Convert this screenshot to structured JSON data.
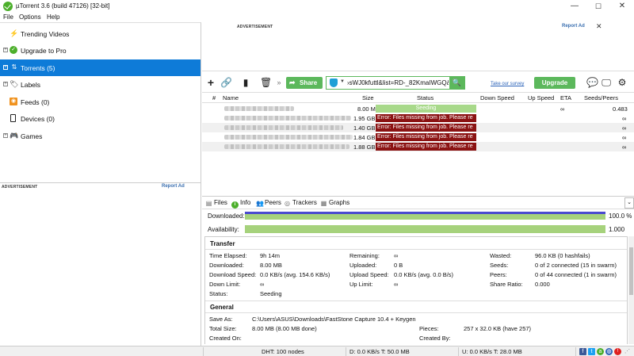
{
  "window": {
    "title": "µTorrent 3.6  (build 47126) [32-bit]",
    "minimize": "—",
    "maximize": "☐",
    "close": "✕"
  },
  "menu": [
    "File",
    "Options",
    "Help"
  ],
  "sidebar": {
    "items": [
      {
        "label": "Trending Videos",
        "icon": "bolt-icon"
      },
      {
        "label": "Upgrade to Pro",
        "icon": "utorrent-logo-icon"
      },
      {
        "label": "Torrents (5)",
        "icon": "torrents-icon",
        "selected": true
      },
      {
        "label": "Labels",
        "icon": "tag-icon"
      },
      {
        "label": "Feeds (0)",
        "icon": "rss-icon"
      },
      {
        "label": "Devices (0)",
        "icon": "device-icon"
      },
      {
        "label": "Games",
        "icon": "gamepad-icon"
      }
    ]
  },
  "ads": {
    "sidebar_label": "ADVERTISEMENT",
    "sidebar_report": "Report Ad",
    "top_label": "ADVERTISEMENT",
    "top_report": "Report Ad",
    "close": "✕"
  },
  "toolbar": {
    "share_label": "Share",
    "url_value": "›sWJ0kfuttl&list=RD-_82KmaIWGQ&index=19",
    "survey_link": "Take our survey",
    "upgrade_label": "Upgrade"
  },
  "table": {
    "columns": [
      "#",
      "Name",
      "Size",
      "Status",
      "Down Speed",
      "Up Speed",
      "ETA",
      "Seeds/Peers"
    ],
    "rows": [
      {
        "size": "8.00 MB",
        "status": "Seeding",
        "status_kind": "seeding",
        "eta": "∞",
        "seeds_peers": "0.483"
      },
      {
        "size": "1.95 GB",
        "status": "Error: Files missing from job. Please re",
        "status_kind": "error",
        "eta": "",
        "seeds_peers": "∞"
      },
      {
        "size": "1.40 GB",
        "status": "Error: Files missing from job. Please re",
        "status_kind": "error",
        "eta": "",
        "seeds_peers": "∞"
      },
      {
        "size": "1.84 GB",
        "status": "Error: Files missing from job. Please re",
        "status_kind": "error",
        "eta": "",
        "seeds_peers": "∞"
      },
      {
        "size": "1.88 GB",
        "status": "Error: Files missing from job. Please re",
        "status_kind": "error",
        "eta": "",
        "seeds_peers": "∞"
      }
    ]
  },
  "detail_tabs": [
    "Files",
    "Info",
    "Peers",
    "Trackers",
    "Graphs"
  ],
  "progress": {
    "downloaded_label": "Downloaded:",
    "downloaded_value": "100.0 %",
    "downloaded_fraction": 1.0,
    "availability_label": "Availability:",
    "availability_value": "1.000",
    "availability_fraction": 1.0
  },
  "transfer": {
    "heading": "Transfer",
    "col1": [
      [
        "Time Elapsed:",
        "9h 14m"
      ],
      [
        "Downloaded:",
        "8.00 MB"
      ],
      [
        "Download Speed:",
        "0.0 KB/s (avg. 154.6 KB/s)"
      ],
      [
        "Down Limit:",
        "∞"
      ],
      [
        "Status:",
        "Seeding"
      ]
    ],
    "col2": [
      [
        "Remaining:",
        "∞"
      ],
      [
        "Uploaded:",
        "0 B"
      ],
      [
        "Upload Speed:",
        "0.0 KB/s (avg. 0.0 B/s)"
      ],
      [
        "Up Limit:",
        "∞"
      ]
    ],
    "col3": [
      [
        "Wasted:",
        "96.0 KB (0 hashfails)"
      ],
      [
        "Seeds:",
        "0 of 2 connected (15 in swarm)"
      ],
      [
        "Peers:",
        "0 of 44 connected (1 in swarm)"
      ],
      [
        "Share Ratio:",
        "0.000"
      ]
    ]
  },
  "general": {
    "heading": "General",
    "save_as_label": "Save As:",
    "save_as_value": "C:\\Users\\ASUS\\Downloads\\FastStone Capture 10.4 + Keygen",
    "total_size_label": "Total Size:",
    "total_size_value": "8.00 MB (8.00 MB done)",
    "pieces_label": "Pieces:",
    "pieces_value": "257 x 32.0 KB (have 257)",
    "created_on_label": "Created On:",
    "created_by_label": "Created By:"
  },
  "statusbar": {
    "dht": "DHT: 100 nodes",
    "down": "D: 0.0 KB/s T: 50.0 MB",
    "up": "U: 0.0 KB/s T: 28.0 MB"
  }
}
